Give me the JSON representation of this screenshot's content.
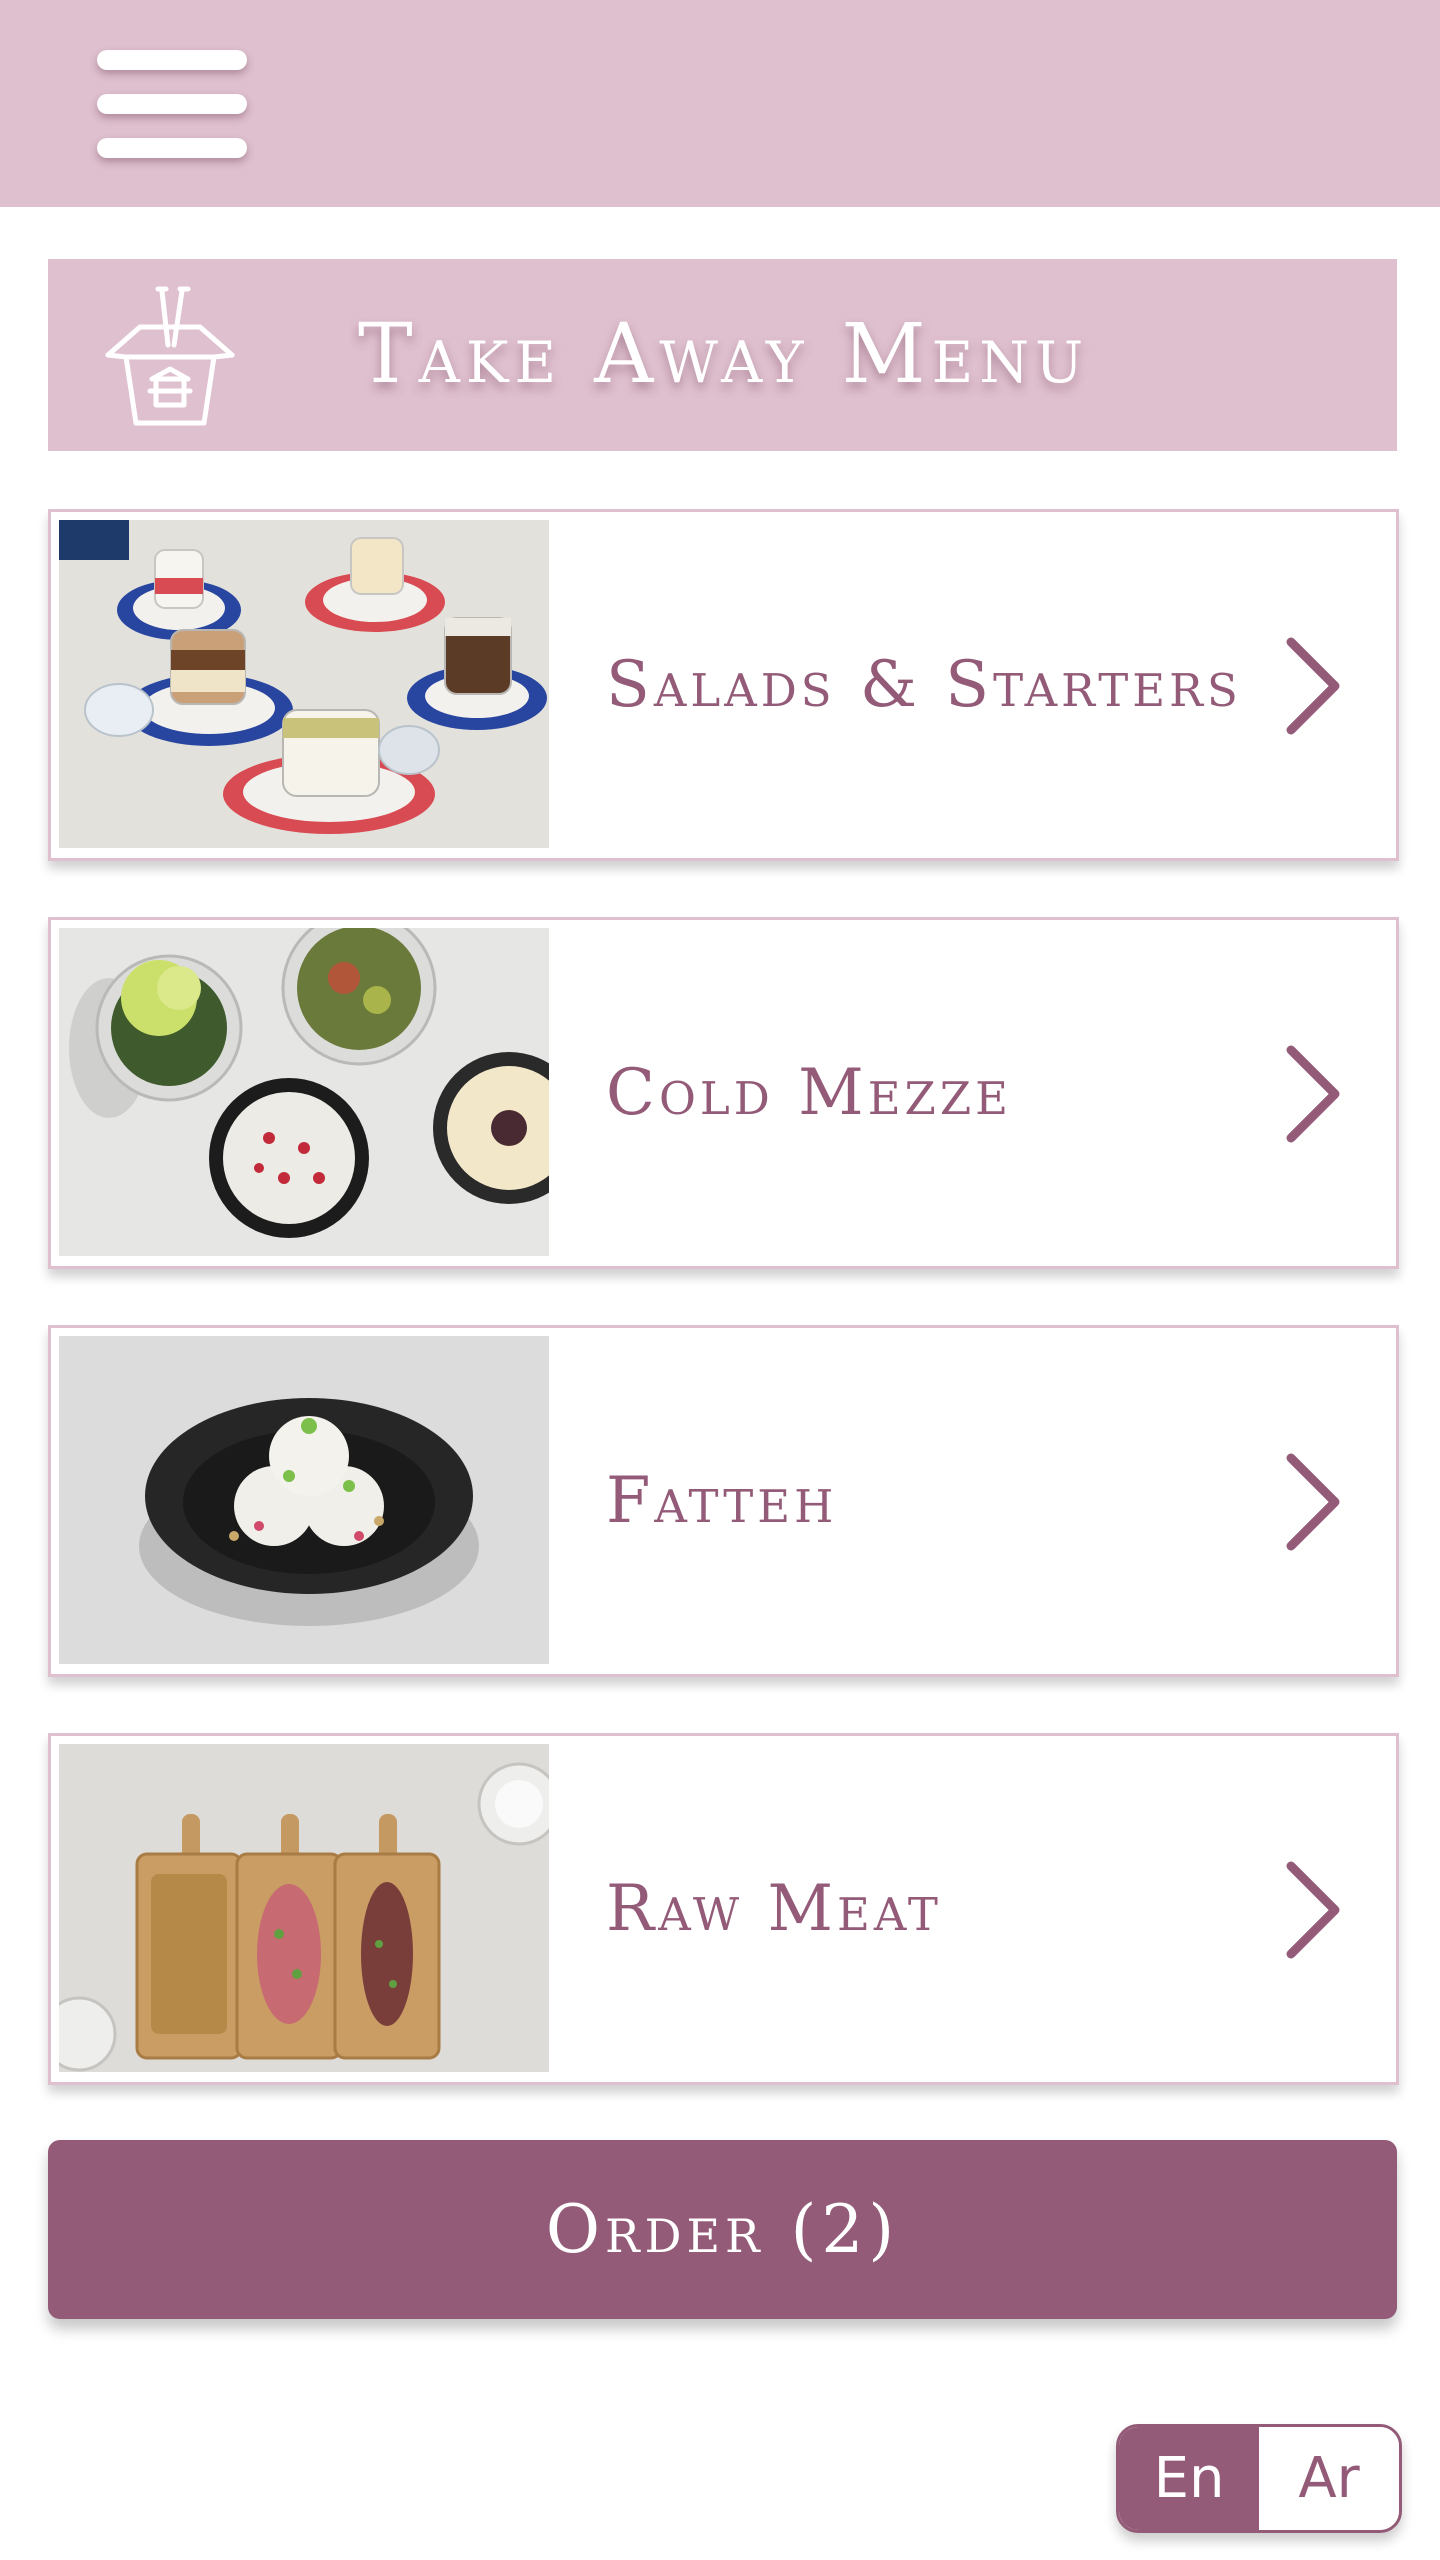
{
  "header": {
    "menu_icon": "hamburger-menu-icon",
    "background_color": "#dfc0cf"
  },
  "banner": {
    "title": "Take Away Menu",
    "icon": "takeaway-box-icon"
  },
  "categories": [
    {
      "label": "Salads & Starters",
      "image": "dessert-jars-photo",
      "icon": "chevron-right-icon"
    },
    {
      "label": "Cold Mezze",
      "image": "mezze-bowls-photo",
      "icon": "chevron-right-icon"
    },
    {
      "label": "Fatteh",
      "image": "fatteh-plate-photo",
      "icon": "chevron-right-icon"
    },
    {
      "label": "Raw Meat",
      "image": "raw-meat-boards-photo",
      "icon": "chevron-right-icon"
    }
  ],
  "order": {
    "label": "Order (2)"
  },
  "language": {
    "options": [
      "En",
      "Ar"
    ],
    "selected": "En"
  },
  "colors": {
    "accent": "#935b78",
    "light_accent": "#dfc0cf"
  }
}
